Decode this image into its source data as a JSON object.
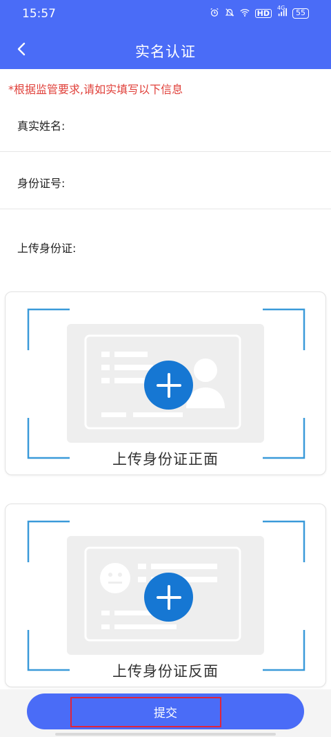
{
  "status_bar": {
    "time": "15:57",
    "network": "4G",
    "hd": "HD",
    "battery": "55",
    "icons": [
      "alarm-icon",
      "mute-icon",
      "wifi-icon",
      "hd-icon",
      "signal-icon",
      "battery-icon"
    ]
  },
  "nav": {
    "title": "实名认证",
    "back_icon": "chevron-left-icon"
  },
  "notice": "*根据监管要求,请如实填写以下信息",
  "form": {
    "name_label": "真实姓名:",
    "name_value": "",
    "id_label": "身份证号:",
    "id_value": "",
    "upload_label": "上传身份证:"
  },
  "upload": {
    "front_caption": "上传身份证正面",
    "back_caption": "上传身份证反面",
    "plus_icon": "plus-icon"
  },
  "submit_label": "提交",
  "colors": {
    "header": "#4a6cf7",
    "notice": "#e0403a",
    "plus": "#1677d3",
    "frame": "#3a9ad9",
    "highlight": "#e0243b"
  }
}
